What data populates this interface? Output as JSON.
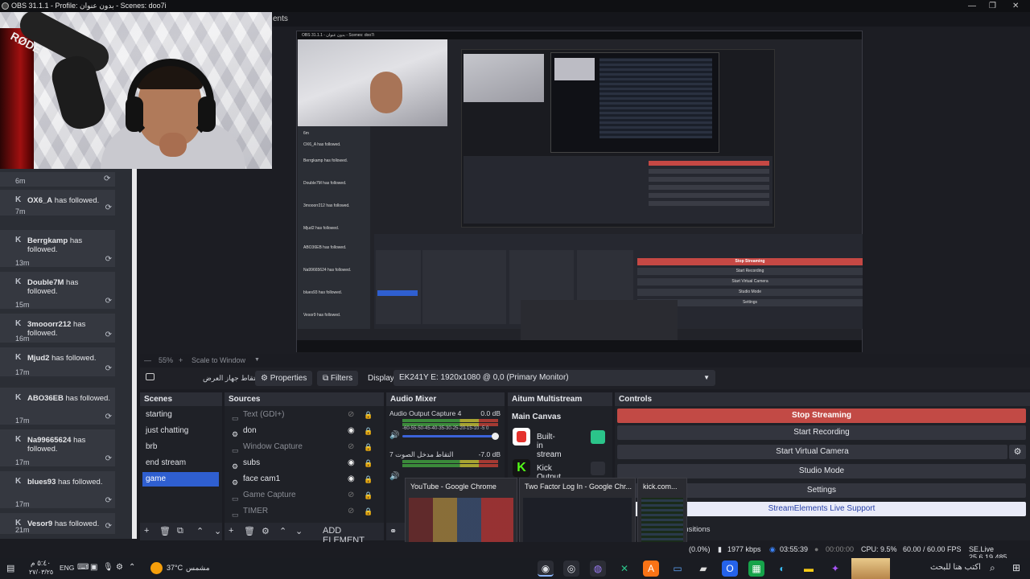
{
  "window": {
    "title": "OBS 31.1.1 - Profile: بدون عنوان - Scenes: doo7i",
    "menu_fragment": "ents"
  },
  "chat": {
    "first_time": "6m",
    "items": [
      {
        "name": "OX6_A",
        "text": "has followed.",
        "time": "7m"
      },
      {
        "name": "Berrgkamp",
        "text": "has followed.",
        "time": "13m"
      },
      {
        "name": "Double7M",
        "text": "has followed.",
        "time": "15m"
      },
      {
        "name": "3mooorr212",
        "text": "has followed.",
        "time": "16m"
      },
      {
        "name": "Mjud2",
        "text": "has followed.",
        "time": "17m"
      },
      {
        "name": "ABO36EB",
        "text": "has followed.",
        "time": "17m"
      },
      {
        "name": "Na99665624",
        "text": "has followed.",
        "time": "17m"
      },
      {
        "name": "blues93",
        "text": "has followed.",
        "time": "17m"
      },
      {
        "name": "Vesor9",
        "text": "has followed.",
        "time": "21m"
      }
    ]
  },
  "zoom": {
    "minus": "—",
    "value": "55%",
    "plus": "+",
    "mode": "Scale to Window",
    "caret": "▼"
  },
  "props": {
    "source_name": "التقاط جهاز العرض",
    "properties_label": "Properties",
    "filters_label": "Filters",
    "display_label": "Display",
    "display_value": "EK241Y E: 1920x1080 @ 0,0 (Primary Monitor)"
  },
  "scenes": {
    "title": "Scenes",
    "items": [
      "starting",
      "just chatting",
      "brb",
      "end stream",
      "game"
    ],
    "selected": "game"
  },
  "sources": {
    "title": "Sources",
    "items": [
      {
        "name": "Text (GDI+)",
        "visible": false
      },
      {
        "name": "don",
        "visible": true
      },
      {
        "name": "Window Capture",
        "visible": false
      },
      {
        "name": "subs",
        "visible": true
      },
      {
        "name": "face cam1",
        "visible": true
      },
      {
        "name": "Game Capture",
        "visible": false
      },
      {
        "name": "TIMER",
        "visible": false
      }
    ],
    "add_element": "ADD ELEMENT"
  },
  "mixer": {
    "title": "Audio Mixer",
    "channels": [
      {
        "name": "Audio Output Capture 4",
        "db": "0.0 dB"
      },
      {
        "name": "التقاط مدخل الصوت 7",
        "db": "-7.0 dB"
      }
    ],
    "scale": "-60-55-50-45-40-35-30-25-20-15-10 -5 0"
  },
  "multistream": {
    "title": "Aitum Multistream",
    "canvas": "Main Canvas",
    "outputs": [
      {
        "label": "Built-in stream",
        "color": "#e5322d"
      },
      {
        "label": "Kick Output",
        "color": "#53fc18"
      }
    ]
  },
  "controls": {
    "title": "Controls",
    "stop_streaming": "Stop Streaming",
    "start_recording": "Start Recording",
    "start_virtual_camera": "Start Virtual Camera",
    "studio_mode": "Studio Mode",
    "settings": "Settings",
    "se_support": "StreamElements Live Support"
  },
  "transitions_fragment": "ansitions",
  "taskbar_previews": [
    {
      "title": "YouTube - Google Chrome"
    },
    {
      "title": "Two Factor Log In - Google Chr..."
    },
    {
      "title": "kick.com..."
    }
  ],
  "status": {
    "dropped": "(0.0%)",
    "bitrate": "1977 kbps",
    "stream_time": "03:55:39",
    "rec_time": "00:00:00",
    "cpu": "CPU: 9.5%",
    "fps": "60.00 / 60.00 FPS",
    "version": "SE.Live 25.6.19.485"
  },
  "taskbar": {
    "time": "٥:٤٠ م",
    "date": "٢٧/٠٣/٢٥",
    "lang": "ENG",
    "weather_temp": "37°C",
    "weather_desc": "مشمس",
    "search_placeholder": "اكتب هنا للبحث"
  },
  "nested": {
    "title": "OBS 31.1.1 - بدون عنوان - Scenes: doo7i"
  },
  "colors": {
    "stop_red": "#c24a45",
    "scene_selected": "#2f5fd0",
    "kick_green": "#53fc18",
    "add_element_orange": "#e07a42"
  }
}
